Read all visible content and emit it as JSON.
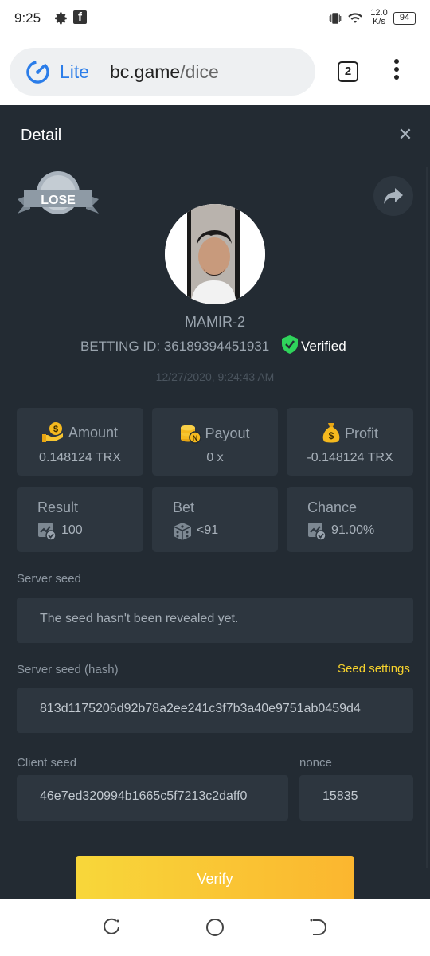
{
  "status_bar": {
    "time": "9:25",
    "network_speed_value": "12.0",
    "network_speed_unit": "K/s",
    "battery": "94"
  },
  "browser": {
    "mode_label": "Lite",
    "url_host": "bc.game",
    "url_path": "/dice",
    "tab_count": "2"
  },
  "detail": {
    "title": "Detail",
    "result_badge": "LOSE",
    "username": "MAMIR-2",
    "betting_id": "BETTING ID: 36189394451931",
    "verified_label": "Verified",
    "datetime": "12/27/2020, 9:24:43 AM",
    "stats": [
      {
        "label": "Amount",
        "value": "0.148124 TRX",
        "icon": "money-hand-icon"
      },
      {
        "label": "Payout",
        "value": "0 x",
        "icon": "coins-icon"
      },
      {
        "label": "Profit",
        "value": "-0.148124 TRX",
        "icon": "money-bag-icon"
      }
    ],
    "result": {
      "label": "Result",
      "value": "100"
    },
    "bet": {
      "label": "Bet",
      "value": "<91"
    },
    "chance": {
      "label": "Chance",
      "value": "91.00%"
    },
    "server_seed_label": "Server seed",
    "server_seed_value": "The seed hasn't been revealed yet.",
    "server_seed_hash_label": "Server seed (hash)",
    "seed_settings_label": "Seed settings",
    "server_seed_hash_value": "813d1175206d92b78a2ee241c3f7b3a40e9751ab0459d4",
    "client_seed_label": "Client seed",
    "client_seed_value": "46e7ed320994b1665c5f7213c2daff0",
    "nonce_label": "nonce",
    "nonce_value": "15835",
    "verify_label": "Verify"
  },
  "colors": {
    "panel_bg": "#232b33",
    "card_bg": "#2d363f",
    "accent_yellow": "#f7d32d",
    "verified_green": "#2fd35b",
    "browser_blue": "#2b7de9"
  }
}
